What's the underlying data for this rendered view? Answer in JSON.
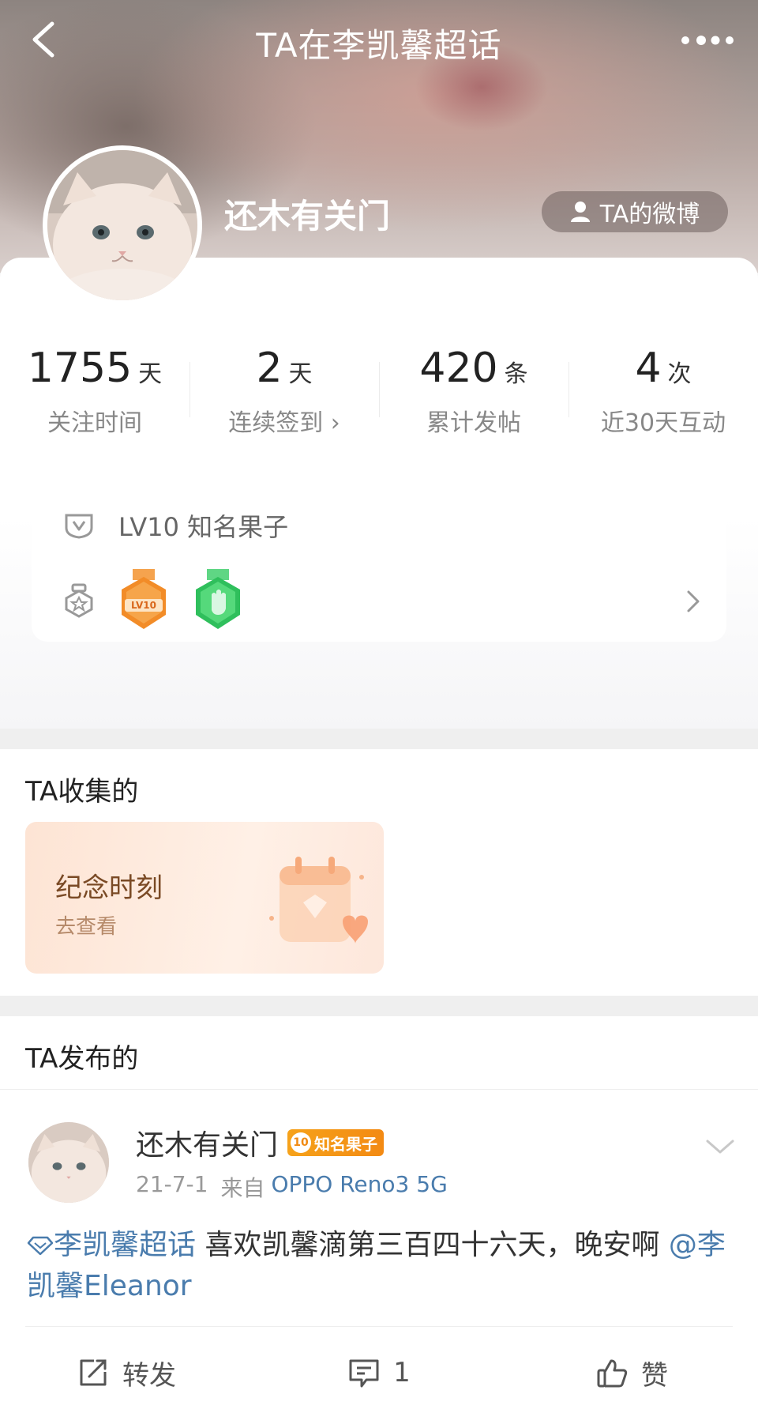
{
  "nav": {
    "title": "TA在李凯馨超话",
    "back_icon": "chevron-left-icon",
    "more_icon": "more-dots-icon"
  },
  "profile": {
    "name": "还木有关门",
    "weibo_button": "TA的微博",
    "weibo_icon": "user-icon"
  },
  "stats": [
    {
      "value": "1755",
      "unit": "天",
      "label": "关注时间"
    },
    {
      "value": "2",
      "unit": "天",
      "label": "连续签到 ›"
    },
    {
      "value": "420",
      "unit": "条",
      "label": "累计发帖"
    },
    {
      "value": "4",
      "unit": "次",
      "label": "近30天互动"
    }
  ],
  "level": {
    "text": "LV10 知名果子",
    "badge_labels": [
      "LV10"
    ]
  },
  "collected": {
    "title": "TA收集的",
    "card_title": "纪念时刻",
    "card_sub": "去查看"
  },
  "posts": {
    "title": "TA发布的",
    "item": {
      "author": "还木有关门",
      "fan_level": "10",
      "fan_badge": "知名果子",
      "date": "21-7-1",
      "source_prefix": "来自",
      "source": "OPPO Reno3 5G",
      "topic": "李凯馨超话",
      "text": " 喜欢凯馨滴第三百四十六天，晚安啊 ",
      "mention": "@李凯馨Eleanor",
      "repost_label": "转发",
      "comment_count": "1",
      "like_label": "赞"
    }
  },
  "colors": {
    "link": "#4a7cad",
    "badge_orange": "#f38a13",
    "badge_green": "#2fbf5c"
  }
}
